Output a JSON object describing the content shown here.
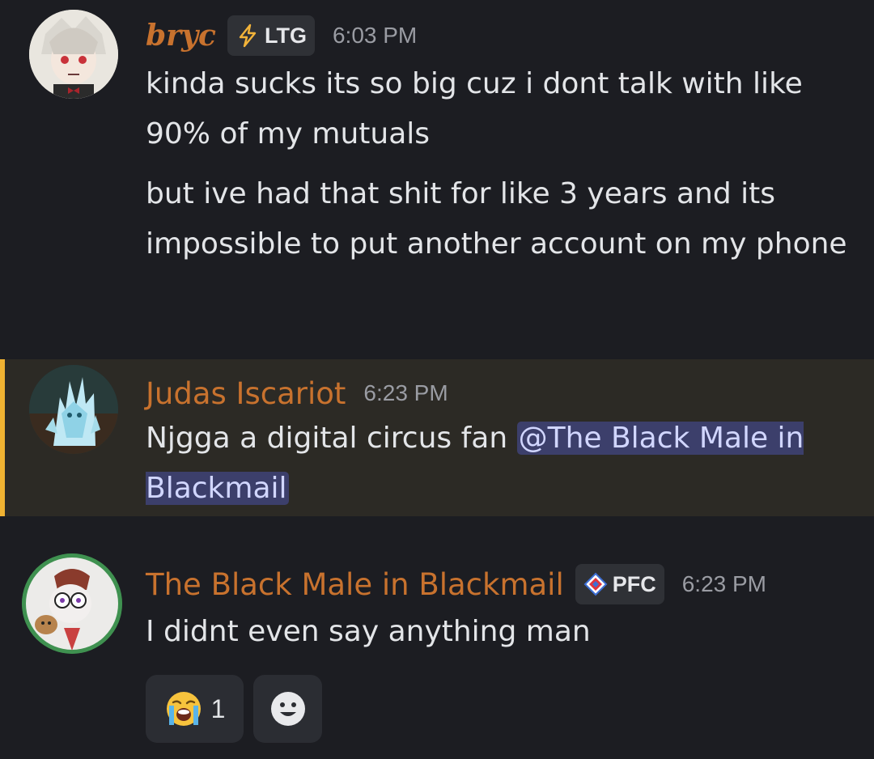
{
  "messages": [
    {
      "username": "bryc",
      "tag": "LTG",
      "time": "6:03 PM",
      "lines": [
        "kinda sucks its so big cuz i dont talk with like 90% of my mutuals",
        "but ive had that shit for like 3 years and its impossible to put another account on my phone"
      ]
    },
    {
      "username": "Judas Iscariot",
      "time": "6:23 PM",
      "text": "Njgga a digital circus fan ",
      "mention": "@The Black Male in Blackmail"
    },
    {
      "username": "The Black Male in Blackmail",
      "tag": "PFC",
      "time": "6:23 PM",
      "text": "I didnt even say anything man"
    }
  ],
  "reactions": [
    {
      "emoji": "loudly-crying-face",
      "count": "1"
    },
    {
      "emoji": "add-reaction-smiley"
    }
  ],
  "colors": {
    "background": "#1c1d22",
    "username": "#c8722e",
    "mention_bg": "#3c3f6b",
    "mention_text": "#d1d6ff",
    "highlight_bar": "#f0b232",
    "highlight_bg": "#2c2a25"
  }
}
